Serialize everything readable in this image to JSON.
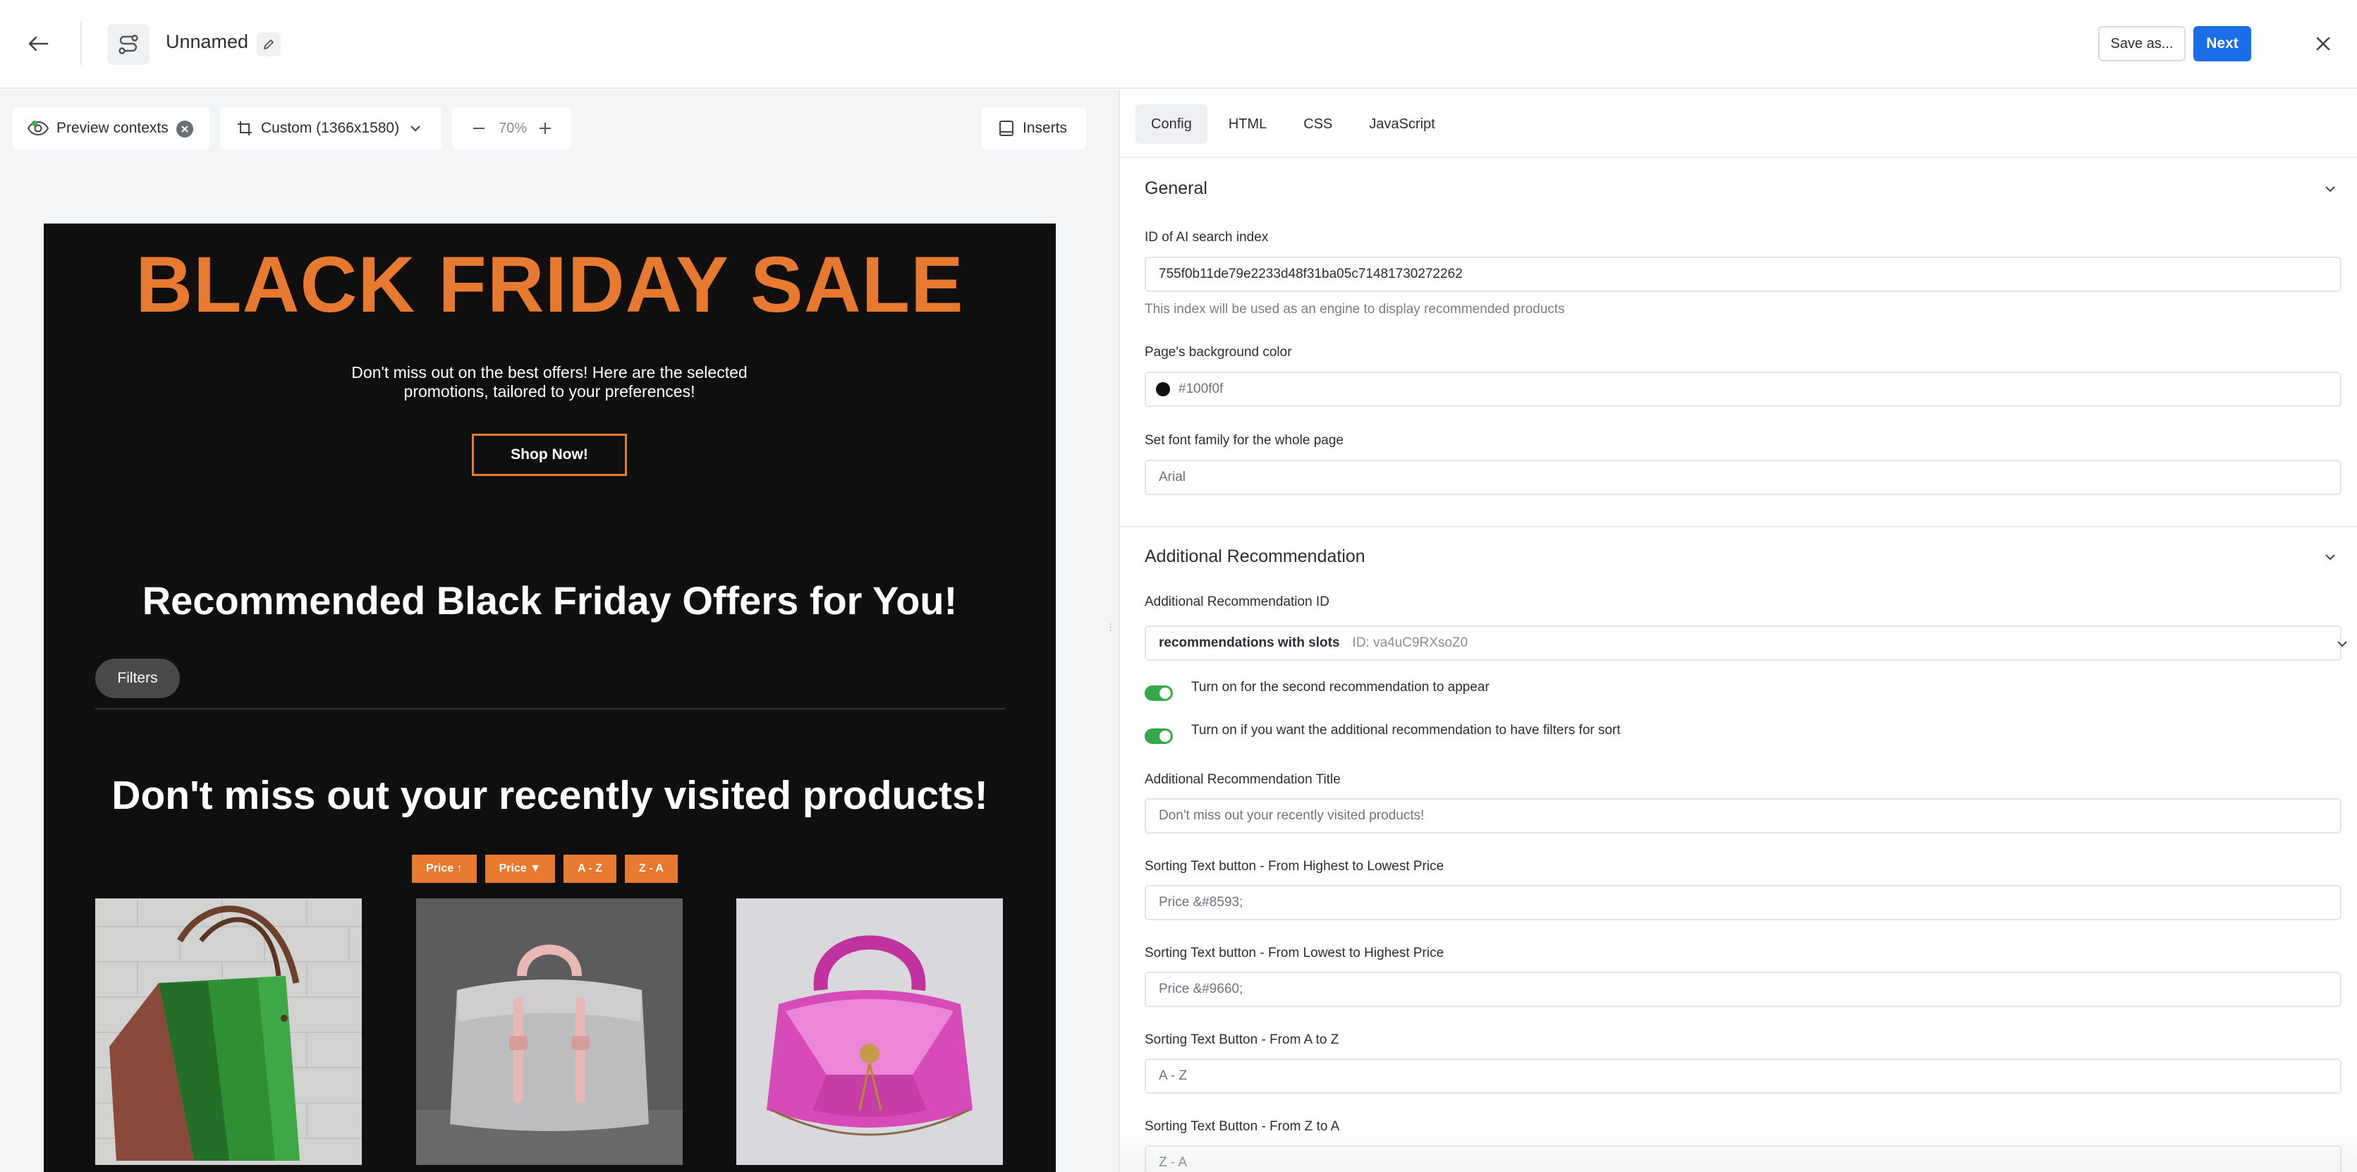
{
  "header": {
    "template_name": "Unnamed",
    "save_as_label": "Save as...",
    "next_label": "Next"
  },
  "preview_toolbar": {
    "preview_contexts_label": "Preview contexts",
    "size_label": "Custom (1366x1580)",
    "zoom_value": "70%",
    "inserts_label": "Inserts"
  },
  "email": {
    "background_color": "#100f0f",
    "accent_color": "#e77a2e",
    "hero_title": "BLACK FRIDAY SALE",
    "hero_subtitle": "Don't miss out on the best offers! Here are the selected promotions, tailored to your preferences!",
    "shop_button": "Shop Now!",
    "recommended_title": "Recommended Black Friday Offers for You!",
    "filters_button": "Filters",
    "visited_title": "Don't miss out your recently visited products!",
    "sort_buttons": [
      "Price ↑",
      "Price ▼",
      "A - Z",
      "Z - A"
    ],
    "products": [
      {
        "image": "green-leather-tote-bag"
      },
      {
        "image": "grey-handbag-pink-handles"
      },
      {
        "image": "pink-glitter-handbag"
      }
    ]
  },
  "config": {
    "tabs": [
      "Config",
      "HTML",
      "CSS",
      "JavaScript"
    ],
    "active_tab": "Config",
    "general": {
      "title": "General",
      "ai_index_label": "ID of AI search index",
      "ai_index_value": "755f0b11de79e2233d48f31ba05c71481730272262",
      "ai_index_help": "This index will be used as an engine to display recommended products",
      "bg_color_label": "Page's background color",
      "bg_color_value": "#100f0f",
      "font_family_label": "Set font family for the whole page",
      "font_family_value": "Arial"
    },
    "additional": {
      "title": "Additional Recommendation",
      "rec_id_label": "Additional Recommendation ID",
      "rec_id_value": "recommendations with slots",
      "rec_id_id": "ID: va4uC9RXsoZ0",
      "toggle_second_label": "Turn on for the second recommendation to appear",
      "toggle_filters_label": "Turn on if you want the additional recommendation to have filters for sort",
      "rec_title_label": "Additional Recommendation Title",
      "rec_title_value": "Don't miss out your recently visited products!",
      "sort_high_low_label": "Sorting Text button - From Highest to Lowest Price",
      "sort_high_low_value": "Price &#8593;",
      "sort_low_high_label": "Sorting Text button - From Lowest to Highest Price",
      "sort_low_high_value": "Price &#9660;",
      "sort_a_z_label": "Sorting Text Button - From A to Z",
      "sort_a_z_value": "A - Z",
      "sort_z_a_label": "Sorting Text Button - From Z to A",
      "sort_z_a_value": "Z - A"
    }
  }
}
